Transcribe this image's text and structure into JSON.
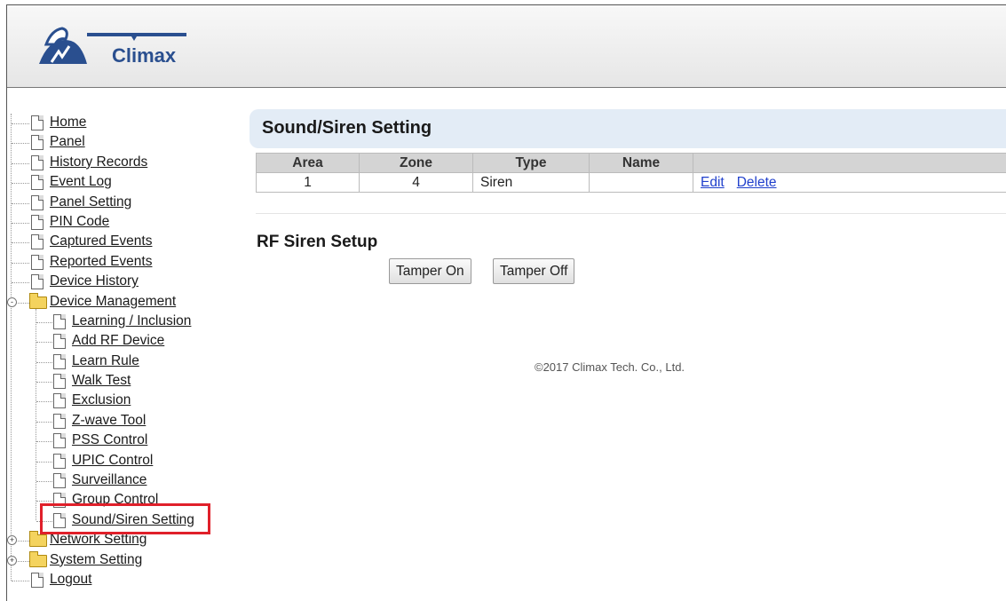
{
  "header": {
    "logo_text": "Climax"
  },
  "sidebar": {
    "items": [
      {
        "label": "Home",
        "level": 0,
        "kind": "doc"
      },
      {
        "label": "Panel",
        "level": 0,
        "kind": "doc"
      },
      {
        "label": "History Records",
        "level": 0,
        "kind": "doc"
      },
      {
        "label": "Event Log",
        "level": 0,
        "kind": "doc"
      },
      {
        "label": "Panel Setting",
        "level": 0,
        "kind": "doc"
      },
      {
        "label": "PIN Code",
        "level": 0,
        "kind": "doc"
      },
      {
        "label": "Captured Events",
        "level": 0,
        "kind": "doc"
      },
      {
        "label": "Reported Events",
        "level": 0,
        "kind": "doc"
      },
      {
        "label": "Device History",
        "level": 0,
        "kind": "doc"
      },
      {
        "label": "Device Management",
        "level": 0,
        "kind": "folder",
        "expander": "-"
      },
      {
        "label": "Learning / Inclusion",
        "level": 1,
        "kind": "doc"
      },
      {
        "label": "Add RF Device",
        "level": 1,
        "kind": "doc"
      },
      {
        "label": "Learn Rule",
        "level": 1,
        "kind": "doc"
      },
      {
        "label": "Walk Test",
        "level": 1,
        "kind": "doc"
      },
      {
        "label": "Exclusion",
        "level": 1,
        "kind": "doc"
      },
      {
        "label": "Z-wave Tool",
        "level": 1,
        "kind": "doc"
      },
      {
        "label": "PSS Control",
        "level": 1,
        "kind": "doc"
      },
      {
        "label": "UPIC Control",
        "level": 1,
        "kind": "doc"
      },
      {
        "label": "Surveillance",
        "level": 1,
        "kind": "doc"
      },
      {
        "label": "Group Control",
        "level": 1,
        "kind": "doc"
      },
      {
        "label": "Sound/Siren Setting",
        "level": 1,
        "kind": "doc",
        "selected": true
      },
      {
        "label": "Network Setting",
        "level": 0,
        "kind": "folder",
        "expander": "+"
      },
      {
        "label": "System Setting",
        "level": 0,
        "kind": "folder",
        "expander": "+"
      },
      {
        "label": "Logout",
        "level": 0,
        "kind": "doc"
      }
    ]
  },
  "main": {
    "title": "Sound/Siren Setting",
    "table": {
      "headers": [
        "Area",
        "Zone",
        "Type",
        "Name",
        ""
      ],
      "rows": [
        {
          "area": "1",
          "zone": "4",
          "type": "Siren",
          "name": "",
          "edit": "Edit",
          "delete": "Delete"
        }
      ]
    },
    "rf_siren": {
      "title": "RF Siren Setup",
      "tamper_on": "Tamper On",
      "tamper_off": "Tamper Off"
    },
    "copyright": "©2017 Climax Tech. Co., Ltd."
  },
  "colors": {
    "accent_title_bg": "#e3ecf6",
    "link": "#1f3fcc",
    "highlight": "#e0202a",
    "brand": "#2a4f8f"
  }
}
